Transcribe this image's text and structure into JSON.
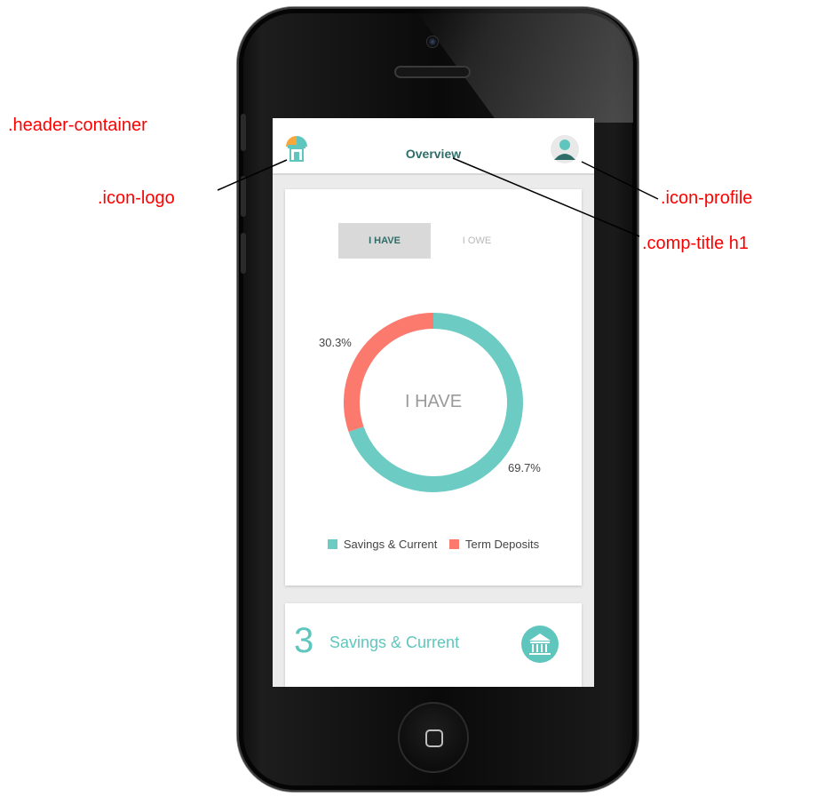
{
  "annotations": {
    "header_container": ".header-container",
    "icon_logo": ".icon-logo",
    "icon_profile": ".icon-profile",
    "comp_title": ".comp-title h1"
  },
  "header": {
    "title": "Overview",
    "logo_icon": "house-logo-icon",
    "profile_icon": "user-avatar-icon"
  },
  "tabs": [
    {
      "label": "I HAVE",
      "active": true
    },
    {
      "label": "I OWE",
      "active": false
    }
  ],
  "chart_data": {
    "type": "pie",
    "center_label": "I HAVE",
    "slices": [
      {
        "name": "Savings & Current",
        "value": 69.7,
        "label": "69.7%",
        "color": "#6ccbc3"
      },
      {
        "name": "Term Deposits",
        "value": 30.3,
        "label": "30.3%",
        "color": "#fb7a6d"
      }
    ]
  },
  "summary_card": {
    "count": "3",
    "label": "Savings & Current",
    "icon": "bank-icon"
  },
  "colors": {
    "accent": "#5fc6bd",
    "title": "#2f6d68",
    "annotation": "#ff0000"
  }
}
